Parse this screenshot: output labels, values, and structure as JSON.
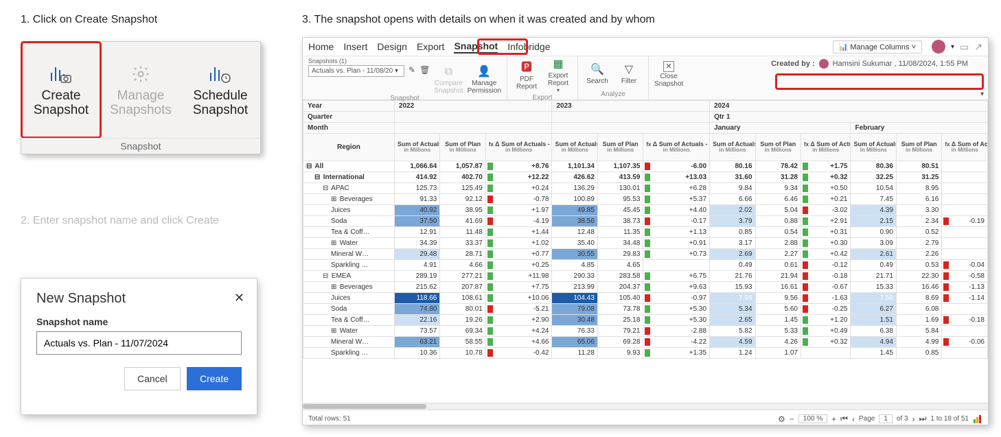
{
  "steps": {
    "one": "1. Click on Create Snapshot",
    "two": "2. Enter snapshot name and click Create",
    "three": "3. The snapshot opens with details on when it was created and by whom"
  },
  "ribbon": {
    "create": "Create\nSnapshot",
    "manage": "Manage\nSnapshots",
    "schedule": "Schedule\nSnapshot",
    "caption": "Snapshot"
  },
  "dialog": {
    "title": "New Snapshot",
    "label": "Snapshot name",
    "value": "Actuals vs. Plan - 11/07/2024",
    "cancel": "Cancel",
    "create": "Create"
  },
  "app": {
    "menu": [
      "Home",
      "Insert",
      "Design",
      "Export",
      "Snapshot",
      "Infobridge"
    ],
    "active_menu": 4,
    "manage_columns": "Manage Columns",
    "snapshots_count_label": "Snapshots (1)",
    "snapshot_combo": "Actuals vs. Plan - 11/08/20",
    "toolbar": {
      "compare": "Compare\nSnapshot",
      "perm": "Manage\nPermission",
      "snapshot_cap": "Snapshot",
      "pdf": "PDF\nReport",
      "excel": "Export\nReport",
      "export_cap": "Export",
      "search": "Search",
      "filter": "Filter",
      "analyze_cap": "Analyze",
      "close": "Close\nSnapshot"
    },
    "created_by_label": "Created by :",
    "created_by_value": "Hamsini Sukumar , 11/08/2024, 1:55 PM",
    "header_rows": {
      "year": "Year",
      "quarter": "Quarter",
      "month": "Month",
      "region": "Region",
      "years": [
        "2022",
        "2023",
        "2024"
      ],
      "qtr": "Qtr 1",
      "months": [
        "January",
        "February"
      ],
      "col_actuals": "Sum of Actuals",
      "col_plan": "Sum of Plan",
      "col_delta": "Δ Sum of Actuals - Sum of Plan",
      "col_delta_short": "Δ Sum of Actuals - of Plan",
      "unit": "in Millions"
    },
    "rows": [
      {
        "label": "All",
        "ind": 0,
        "exp": "-",
        "vals": [
          "1,066.64",
          "1,057.87",
          "+8.76",
          "1,101.34",
          "1,107.35",
          "-6.00",
          "80.16",
          "78.42",
          "+1.75",
          "80.36",
          "80.51",
          ""
        ]
      },
      {
        "label": "International",
        "ind": 1,
        "exp": "-",
        "vals": [
          "414.92",
          "402.70",
          "+12.22",
          "426.62",
          "413.59",
          "+13.03",
          "31.60",
          "31.28",
          "+0.32",
          "32.25",
          "31.25",
          ""
        ],
        "bold": true
      },
      {
        "label": "APAC",
        "ind": 2,
        "exp": "-",
        "vals": [
          "125.73",
          "125.49",
          "+0.24",
          "136.29",
          "130.01",
          "+6.28",
          "9.84",
          "9.34",
          "+0.50",
          "10.54",
          "8.95",
          ""
        ]
      },
      {
        "label": "Beverages",
        "ind": 3,
        "exp": "+",
        "vals": [
          "91.33",
          "92.12",
          "-0.78",
          "100.89",
          "95.53",
          "+5.37",
          "6.66",
          "6.46",
          "+0.21",
          "7.45",
          "6.16",
          ""
        ]
      },
      {
        "label": "Juices",
        "ind": 3,
        "vals": [
          "40.92",
          "38.95",
          "+1.97",
          "49.85",
          "45.45",
          "+4.40",
          "2.02",
          "5.04",
          "-3.02",
          "4.39",
          "3.30",
          ""
        ],
        "hl": [
          0,
          3,
          6,
          9
        ]
      },
      {
        "label": "Soda",
        "ind": 3,
        "vals": [
          "37.50",
          "41.69",
          "-4.19",
          "38.56",
          "38.73",
          "-0.17",
          "3.79",
          "0.88",
          "+2.91",
          "2.15",
          "2.34",
          "-0.19"
        ],
        "hl": [
          0,
          3,
          6,
          9
        ]
      },
      {
        "label": "Tea & Coff…",
        "ind": 3,
        "vals": [
          "12.91",
          "11.48",
          "+1.44",
          "12.48",
          "11.35",
          "+1.13",
          "0.85",
          "0.54",
          "+0.31",
          "0.90",
          "0.52",
          ""
        ]
      },
      {
        "label": "Water",
        "ind": 3,
        "exp": "+",
        "vals": [
          "34.39",
          "33.37",
          "+1.02",
          "35.40",
          "34.48",
          "+0.91",
          "3.17",
          "2.88",
          "+0.30",
          "3.09",
          "2.79",
          ""
        ]
      },
      {
        "label": "Mineral W…",
        "ind": 3,
        "vals": [
          "29.48",
          "28.71",
          "+0.77",
          "30.55",
          "29.83",
          "+0.73",
          "2.69",
          "2.27",
          "+0.42",
          "2.61",
          "2.26",
          ""
        ],
        "hl": [
          0,
          3,
          6,
          9
        ]
      },
      {
        "label": "Sparkling …",
        "ind": 3,
        "vals": [
          "4.91",
          "4.66",
          "+0.25",
          "4.85",
          "4.65",
          "",
          "0.49",
          "0.61",
          "-0.12",
          "0.49",
          "0.53",
          "-0.04"
        ]
      },
      {
        "label": "EMEA",
        "ind": 2,
        "exp": "-",
        "vals": [
          "289.19",
          "277.21",
          "+11.98",
          "290.33",
          "283.58",
          "+6.75",
          "21.76",
          "21.94",
          "-0.18",
          "21.71",
          "22.30",
          "-0.58"
        ]
      },
      {
        "label": "Beverages",
        "ind": 3,
        "exp": "+",
        "vals": [
          "215.62",
          "207.87",
          "+7.75",
          "213.99",
          "204.37",
          "+9.63",
          "15.93",
          "16.61",
          "-0.67",
          "15.33",
          "16.46",
          "-1.13"
        ]
      },
      {
        "label": "Juices",
        "ind": 3,
        "vals": [
          "118.66",
          "108.61",
          "+10.06",
          "104.43",
          "105.40",
          "-0.97",
          "7.94",
          "9.56",
          "-1.63",
          "7.56",
          "8.69",
          "-1.14"
        ],
        "hl": [
          0,
          3,
          6,
          9
        ],
        "dark": true
      },
      {
        "label": "Soda",
        "ind": 3,
        "vals": [
          "74.80",
          "80.01",
          "-5.21",
          "79.08",
          "73.78",
          "+5.30",
          "5.34",
          "5.60",
          "-0.25",
          "6.27",
          "6.08",
          ""
        ],
        "hl": [
          0,
          3,
          6,
          9
        ]
      },
      {
        "label": "Tea & Coff…",
        "ind": 3,
        "vals": [
          "22.16",
          "19.26",
          "+2.90",
          "30.48",
          "25.18",
          "+5.30",
          "2.65",
          "1.45",
          "+1.20",
          "1.51",
          "1.69",
          "-0.18"
        ],
        "hl": [
          0,
          3,
          6,
          9
        ]
      },
      {
        "label": "Water",
        "ind": 3,
        "exp": "+",
        "vals": [
          "73.57",
          "69.34",
          "+4.24",
          "76.33",
          "79.21",
          "-2.88",
          "5.82",
          "5.33",
          "+0.49",
          "6.38",
          "5.84",
          ""
        ]
      },
      {
        "label": "Mineral W…",
        "ind": 3,
        "vals": [
          "63.21",
          "58.55",
          "+4.66",
          "65.06",
          "69.28",
          "-4.22",
          "4.59",
          "4.26",
          "+0.32",
          "4.94",
          "4.99",
          "-0.06"
        ],
        "hl": [
          0,
          3,
          6,
          9
        ]
      },
      {
        "label": "Sparkling …",
        "ind": 3,
        "vals": [
          "10.36",
          "10.78",
          "-0.42",
          "11.28",
          "9.93",
          "+1.35",
          "1.24",
          "1.07",
          "",
          "1.45",
          "0.85",
          ""
        ]
      }
    ],
    "status": {
      "total_rows": "Total rows: 51",
      "zoom": "100 %",
      "page_lbl": "Page",
      "page_cur": "1",
      "page_of": "of 3",
      "range": "1 to 18 of 51"
    }
  }
}
